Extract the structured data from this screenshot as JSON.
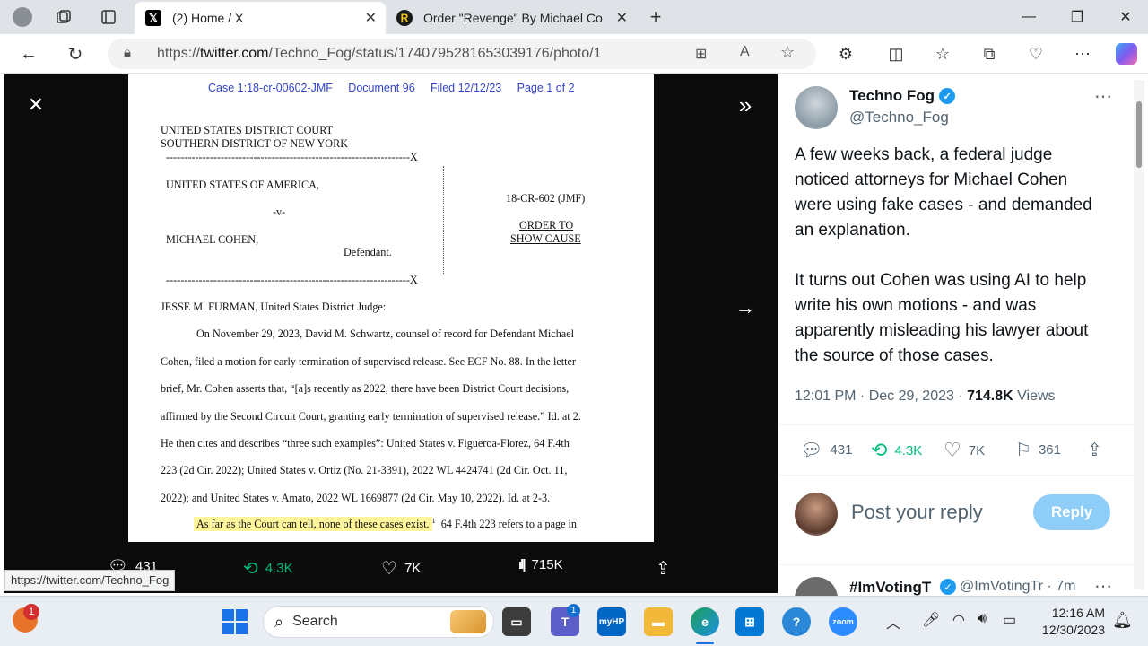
{
  "browser": {
    "tabs": [
      {
        "title": "(2) Home / X",
        "favicon": "x-logo-icon"
      },
      {
        "title": "Order \"Revenge\" By Michael Coh",
        "favicon": "r-logo-icon"
      }
    ],
    "url_prefix": "https://",
    "url_domain": "twitter.com",
    "url_path": "/Techno_Fog/status/1740795281653039176/photo/1",
    "status_url": "https://twitter.com/Techno_Fog"
  },
  "document": {
    "header": "Case 1:18-cr-00602-JMF     Document 96     Filed 12/12/23     Page 1 of 2",
    "court_line1": "UNITED STATES DISTRICT COURT",
    "court_line2": "SOUTHERN DISTRICT OF NEW YORK",
    "rule_line": "-------------------------------------------------------------------X",
    "plaintiff": "UNITED STATES OF AMERICA,",
    "versus": "-v-",
    "defendant": "MICHAEL COHEN,",
    "defendant_role": "Defendant.",
    "case_no": "18-CR-602 (JMF)",
    "order_line1": "ORDER TO",
    "order_line2": "SHOW CAUSE",
    "judge": "JESSE M. FURMAN, United States District Judge:",
    "body": [
      "On November 29, 2023, David M. Schwartz, counsel of record for Defendant Michael",
      "Cohen, filed a motion for early termination of supervised release.  See ECF No. 88.  In the letter",
      "brief, Mr. Cohen asserts that, “[a]s recently as 2022, there have been District Court decisions,",
      "affirmed by the Second Circuit Court, granting early termination of supervised release.”  Id. at 2.",
      "He then cites and describes “three such examples”: United States v. Figueroa-Florez, 64 F.4th",
      "223 (2d Cir. 2022); United States v. Ortiz (No. 21-3391), 2022 WL 4424741 (2d Cir. Oct. 11,",
      "2022); and United States v. Amato, 2022 WL 1669877 (2d Cir. May 10, 2022).  Id. at 2-3."
    ],
    "highlight": "As far as the Court can tell, none of these cases exist.",
    "footnote_mark": "1",
    "last_line_rest": "  64 F.4th 223 refers to a page in"
  },
  "viewer_bar": {
    "replies": "431",
    "retweets": "4.3K",
    "likes": "7K",
    "views": "715K"
  },
  "tweet": {
    "author_name": "Techno Fog",
    "handle": "@Techno_Fog",
    "text_p1": "A few weeks back, a federal judge noticed attorneys for Michael Cohen were using fake cases - and demanded an explanation.",
    "text_p2": "It turns out Cohen was using AI to help write his own motions - and was apparently misleading his lawyer about the source of those cases.",
    "time": "12:01 PM · Dec 29, 2023 · ",
    "views_count": "714.8K",
    "views_label": " Views",
    "replies": "431",
    "retweets": "4.3K",
    "likes": "7K",
    "bookmarks": "361",
    "reply_placeholder": "Post your reply",
    "reply_button": "Reply",
    "next_author": "#ImVotingT",
    "next_handle": "@ImVotingTr · 7m"
  },
  "taskbar": {
    "search_label": "Search",
    "time": "12:16 AM",
    "date": "12/30/2023",
    "notification_badge": "1",
    "teams_badge": "1"
  },
  "colors": {
    "x_blue": "#1d9bf0",
    "retweet_green": "#00ba7c",
    "highlight": "#fff59a",
    "doc_header_blue": "#3344cc"
  }
}
